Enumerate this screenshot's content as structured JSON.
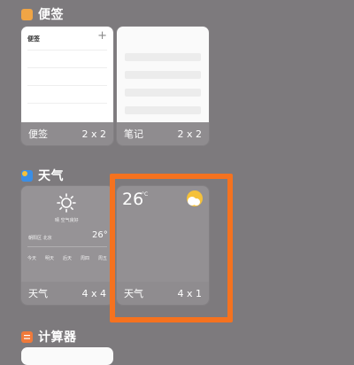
{
  "sections": {
    "notes": {
      "title": "便签"
    },
    "weather": {
      "title": "天气"
    },
    "calculator": {
      "title": "计算器"
    }
  },
  "widgets": {
    "memo": {
      "name": "便签",
      "size": "2 x 2",
      "header": "便签"
    },
    "notes": {
      "name": "笔记",
      "size": "2 x 2"
    },
    "weather_4x4": {
      "name": "天气",
      "size": "4 x 4",
      "current_label": "晴 空气良好",
      "location": "朝阳区 北京",
      "temp": "26°",
      "forecast_days": [
        "今天",
        "明天",
        "后天",
        "周四",
        "周五"
      ]
    },
    "weather_4x1": {
      "name": "天气",
      "size": "4 x 1",
      "temp": "26",
      "unit": "°C"
    }
  },
  "colors": {
    "background": "#7d7a7d",
    "highlight": "#f5721f",
    "notes_icon": "#f0a545",
    "weather_icon": "#3a8ee6",
    "calculator_icon": "#f07a3a",
    "sun": "#f5c13a"
  }
}
